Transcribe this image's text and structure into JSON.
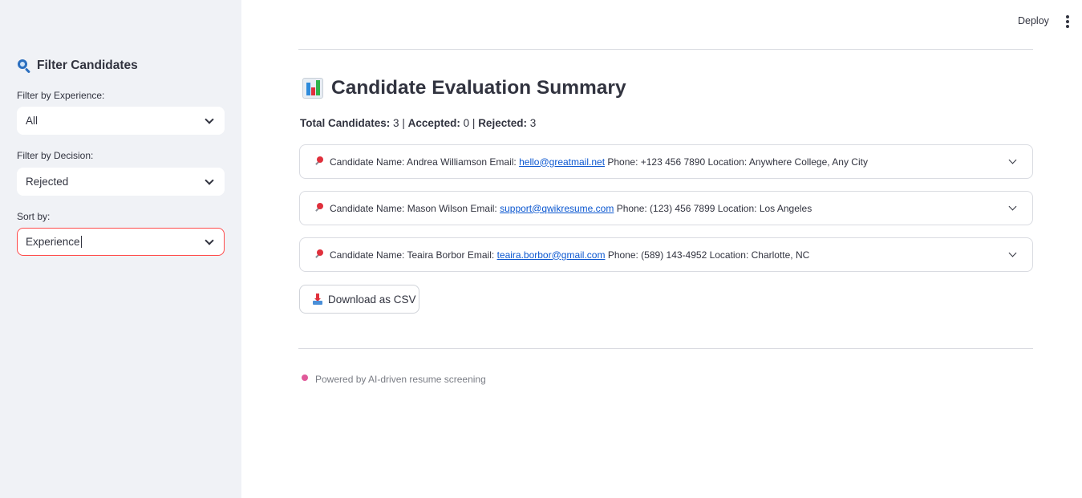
{
  "sidebar": {
    "title": "Filter Candidates",
    "title_icon": "magnifier-icon",
    "experience": {
      "label": "Filter by Experience:",
      "value": "All"
    },
    "decision": {
      "label": "Filter by Decision:",
      "value": "Rejected"
    },
    "sort": {
      "label": "Sort by:",
      "value": "Experience"
    }
  },
  "header": {
    "deploy_label": "Deploy",
    "menu_icon": "vertical-dots-icon"
  },
  "main": {
    "title": "Candidate Evaluation Summary",
    "title_icon": "bar-chart-icon",
    "summary": {
      "total_label": "Total Candidates:",
      "total_value": "3",
      "sep1": "|",
      "accepted_label": "Accepted:",
      "accepted_value": "0",
      "sep2": "|",
      "rejected_label": "Rejected:",
      "rejected_value": "3"
    },
    "candidates": [
      {
        "name_label": "Candidate Name: Andrea Williamson Email:",
        "email": "hello@greatmail.net",
        "rest": "Phone: +123 456 7890 Location: Anywhere College, Any City"
      },
      {
        "name_label": "Candidate Name: Mason Wilson Email:",
        "email": "support@qwikresume.com",
        "rest": "Phone: (123) 456 7899 Location: Los Angeles"
      },
      {
        "name_label": "Candidate Name: Teaira Borbor Email:",
        "email": "teaira.borbor@gmail.com",
        "rest": "Phone: (589) 143-4952 Location: Charlotte, NC"
      }
    ],
    "download_label": "Download as CSV",
    "download_icon": "inbox-tray-icon",
    "footer_text": "Powered by AI-driven resume screening",
    "footer_icon": "pushpin-icon"
  },
  "colors": {
    "sidebar_bg": "#f0f2f6",
    "focus_border": "#ff4b4b",
    "link": "#0b57d0",
    "text": "#31333f"
  }
}
